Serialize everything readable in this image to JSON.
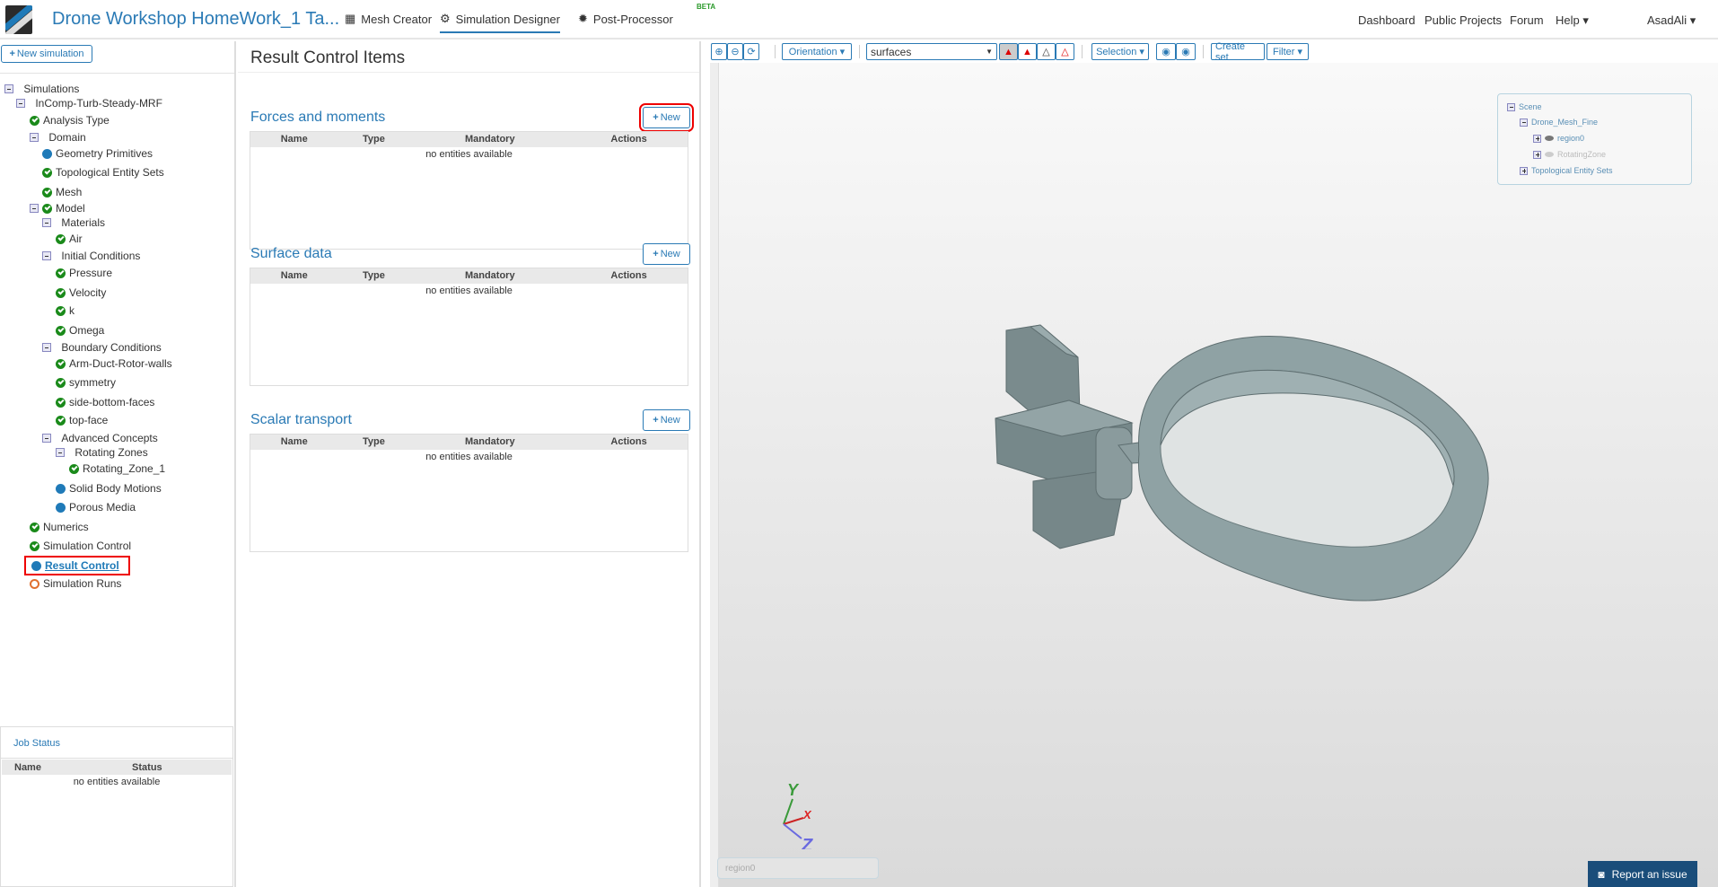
{
  "header": {
    "project_title": "Drone Workshop HomeWork_1 Ta...",
    "nav": [
      "Mesh Creator",
      "Simulation Designer",
      "Post-Processor"
    ],
    "beta": "BETA",
    "right_nav": [
      "Dashboard",
      "Public Projects",
      "Forum",
      "Help"
    ],
    "user": "AsadAli"
  },
  "left": {
    "new_simulation": "New simulation",
    "tree": [
      "Simulations",
      "InComp-Turb-Steady-MRF",
      "Analysis Type",
      "Domain",
      "Geometry Primitives",
      "Topological Entity Sets",
      "Mesh",
      "Model",
      "Materials",
      "Air",
      "Initial Conditions",
      "Pressure",
      "Velocity",
      "k",
      "Omega",
      "Boundary Conditions",
      "Arm-Duct-Rotor-walls",
      "symmetry",
      "side-bottom-faces",
      "top-face",
      "Advanced Concepts",
      "Rotating Zones",
      "Rotating_Zone_1",
      "Solid Body Motions",
      "Porous Media",
      "Numerics",
      "Simulation Control",
      "Result Control",
      "Simulation Runs"
    ],
    "job_status": {
      "title": "Job Status",
      "columns": [
        "Name",
        "Status"
      ],
      "empty": "no entities available"
    }
  },
  "center": {
    "title": "Result Control Items",
    "new_label": "New",
    "columns": [
      "Name",
      "Type",
      "Mandatory",
      "Actions"
    ],
    "sections": [
      {
        "title": "Forces and moments",
        "empty": "no entities available"
      },
      {
        "title": "Surface data",
        "empty": "no entities available"
      },
      {
        "title": "Scalar transport",
        "empty": "no entities available"
      }
    ]
  },
  "viewer": {
    "orientation": "Orientation",
    "render_mode": "surfaces",
    "selection": "Selection",
    "create_set": "Create set",
    "filter": "Filter",
    "scene": [
      "Scene",
      "Drone_Mesh_Fine",
      "region0",
      "RotatingZone",
      "Topological Entity Sets"
    ],
    "axes": [
      "Y",
      "X",
      "Z"
    ],
    "selected_box": "region0",
    "report": "Report an issue"
  }
}
